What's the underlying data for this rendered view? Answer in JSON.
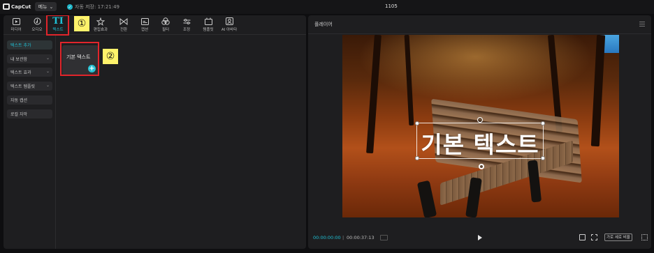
{
  "topbar": {
    "logo_text": "CapCut",
    "menu_label": "메뉴",
    "autosave_text": "자동 저장: 17:21:49",
    "project_title": "1105"
  },
  "toolbar": {
    "items": [
      {
        "label": "미디어",
        "icon": "media-icon"
      },
      {
        "label": "오디오",
        "icon": "audio-icon"
      },
      {
        "label": "텍스트",
        "icon": "text-icon",
        "glyph": "TI"
      },
      {
        "label": "편집효과",
        "icon": "effects-icon"
      },
      {
        "label": "전환",
        "icon": "transition-icon"
      },
      {
        "label": "캡션",
        "icon": "caption-icon"
      },
      {
        "label": "필터",
        "icon": "filter-icon"
      },
      {
        "label": "조정",
        "icon": "adjust-icon"
      },
      {
        "label": "템플릿",
        "icon": "template-icon"
      },
      {
        "label": "AI 아바타",
        "icon": "ai-avatar-icon"
      }
    ]
  },
  "sidebar": {
    "items": [
      {
        "label": "텍스트 추가",
        "active": true
      },
      {
        "label": "내 보관함",
        "dropdown": true
      },
      {
        "label": "텍스트 효과",
        "dropdown": true
      },
      {
        "label": "텍스트 템플릿",
        "dropdown": true
      },
      {
        "label": "자동 캡션"
      },
      {
        "label": "로컬 자막"
      }
    ]
  },
  "text_card": {
    "label": "기본 텍스트"
  },
  "annotations": {
    "step1": "①",
    "step2": "②",
    "highlight_color": "#e1252b",
    "badge_color": "#fff36b"
  },
  "player": {
    "title": "플레이어",
    "overlay_text": "기본 텍스트",
    "current_time": "00:00:00:00",
    "separator": "|",
    "total_time": "00:00:37:13",
    "ratio_label": "가로 세로 비율"
  },
  "colors": {
    "accent": "#1fc2d6"
  }
}
